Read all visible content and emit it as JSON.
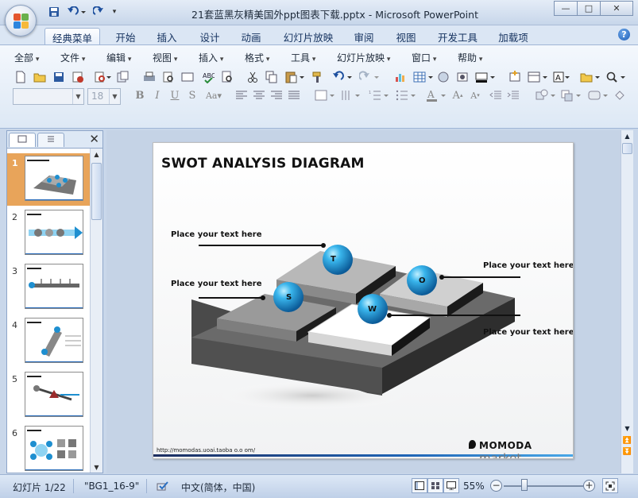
{
  "window": {
    "title": "21套蓝黑灰精美国外ppt图表下载.pptx - Microsoft PowerPoint",
    "controls": [
      "—",
      "□",
      "✕"
    ]
  },
  "quick_access": [
    "save",
    "undo",
    "redo",
    "customize"
  ],
  "tabs": [
    {
      "label": "经典菜单",
      "active": true
    },
    {
      "label": "开始"
    },
    {
      "label": "插入"
    },
    {
      "label": "设计"
    },
    {
      "label": "动画"
    },
    {
      "label": "幻灯片放映"
    },
    {
      "label": "审阅"
    },
    {
      "label": "视图"
    },
    {
      "label": "开发工具"
    },
    {
      "label": "加载项"
    }
  ],
  "menu": [
    "全部",
    "文件",
    "编辑",
    "视图",
    "插入",
    "格式",
    "工具",
    "幻灯片放映",
    "窗口",
    "帮助"
  ],
  "toolbar": {
    "font_size": "18",
    "font_name": ""
  },
  "left_pane": {
    "tabs": [
      "slides-tab",
      "outline-tab"
    ],
    "close": "✕",
    "slides": [
      {
        "num": "1",
        "selected": true
      },
      {
        "num": "2"
      },
      {
        "num": "3"
      },
      {
        "num": "4"
      },
      {
        "num": "5"
      },
      {
        "num": "6"
      }
    ]
  },
  "slide": {
    "title": "SWOT ANALYSIS DIAGRAM",
    "placeholders": [
      "Place your text here",
      "Place your text here",
      "Place your text here",
      "Place your text here"
    ],
    "spheres": [
      "T",
      "O",
      "S",
      "W"
    ],
    "footer_url": "http://momodas.uoai.taoba o.o om/",
    "brand": "MOMODA",
    "brand_suffix": "market"
  },
  "status": {
    "slide_info": "幻灯片 1/22",
    "theme": "\"BG1_16-9\"",
    "language": "中文(简体，中国)",
    "zoom": "55%"
  },
  "colors": {
    "accent": "#1f64b5",
    "sphere": "#1e8fd0",
    "selected_thumb": "#e8a45a"
  }
}
